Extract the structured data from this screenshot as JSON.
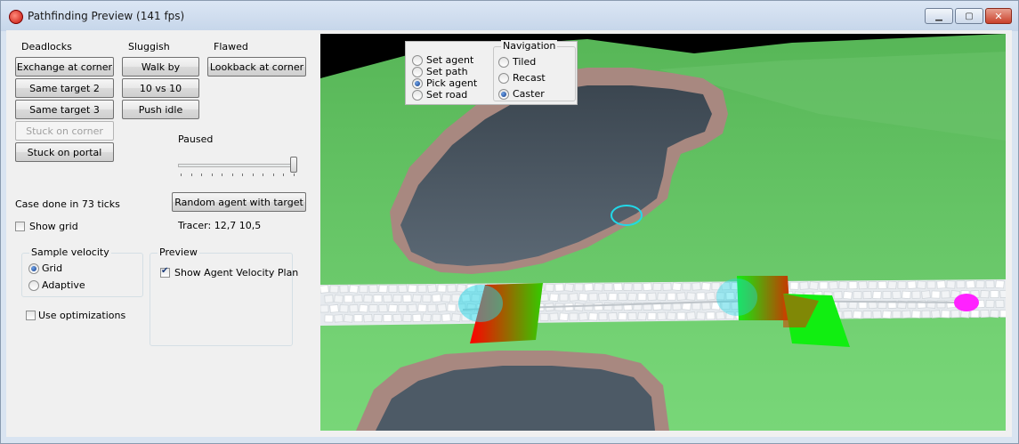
{
  "window": {
    "title": "Pathfinding Preview (141 fps)"
  },
  "titlebar_buttons": {
    "minimize": "▁",
    "maximize": "▢",
    "close": "✕"
  },
  "columns": {
    "deadlocks": "Deadlocks",
    "sluggish": "Sluggish",
    "flawed": "Flawed"
  },
  "buttons": {
    "exchange_at_corner": "Exchange at corner",
    "same_target_2": "Same target 2",
    "same_target_3": "Same target 3",
    "stuck_on_corner": "Stuck on corner",
    "stuck_on_portal": "Stuck on portal",
    "walk_by": "Walk by",
    "ten_vs_ten": "10 vs 10",
    "push_idle": "Push idle",
    "lookback_at_corner": "Lookback at corner",
    "random_agent": "Random agent with target"
  },
  "paused": {
    "label": "Paused",
    "level": 1.0
  },
  "status": {
    "case_done": "Case done in 73 ticks",
    "tracer": "Tracer: 12,7 10,5"
  },
  "checkboxes": {
    "show_grid": {
      "label": "Show grid",
      "checked": false
    },
    "use_optimizations": {
      "label": "Use optimizations",
      "checked": false
    },
    "show_velocity_plan": {
      "label": "Show Agent Velocity Plan",
      "checked": true
    }
  },
  "sample_velocity": {
    "title": "Sample velocity",
    "options": [
      "Grid",
      "Adaptive"
    ],
    "selected": "Grid"
  },
  "preview": {
    "title": "Preview"
  },
  "mode": {
    "options": [
      "Set agent",
      "Set path",
      "Pick agent",
      "Set road"
    ],
    "selected": "Pick agent"
  },
  "navigation": {
    "title": "Navigation",
    "options": [
      "Tiled",
      "Recast",
      "Caster"
    ],
    "selected": "Caster"
  },
  "colors": {
    "terrain": "#6fcf6f",
    "water": "#4d5a66",
    "cliff": "#a88880",
    "road": "#e6eaee",
    "agent_ring": "#22d8e8",
    "target": "#ff22ff"
  }
}
